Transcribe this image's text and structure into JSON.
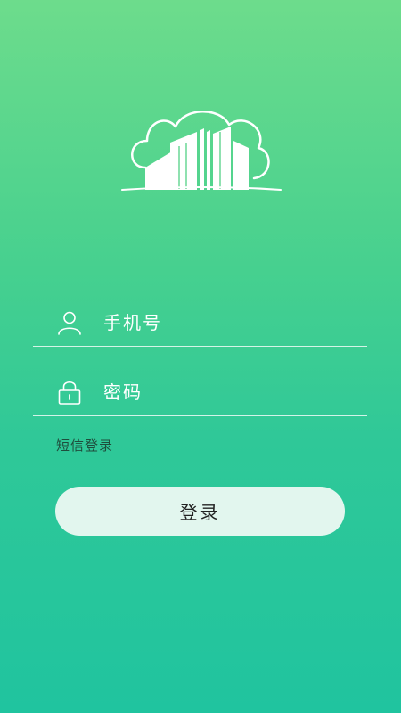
{
  "form": {
    "phone": {
      "placeholder": "手机号",
      "value": "",
      "icon": "user-icon"
    },
    "password": {
      "placeholder": "密码",
      "value": "",
      "icon": "lock-icon"
    },
    "sms_login_label": "短信登录",
    "login_button_label": "登录"
  },
  "logo": {
    "icon": "cloud-buildings-logo"
  },
  "colors": {
    "background_top": "#6ddc8c",
    "background_bottom": "#20c49f",
    "button_background": "#e2f6ee",
    "foreground": "#ffffff"
  }
}
